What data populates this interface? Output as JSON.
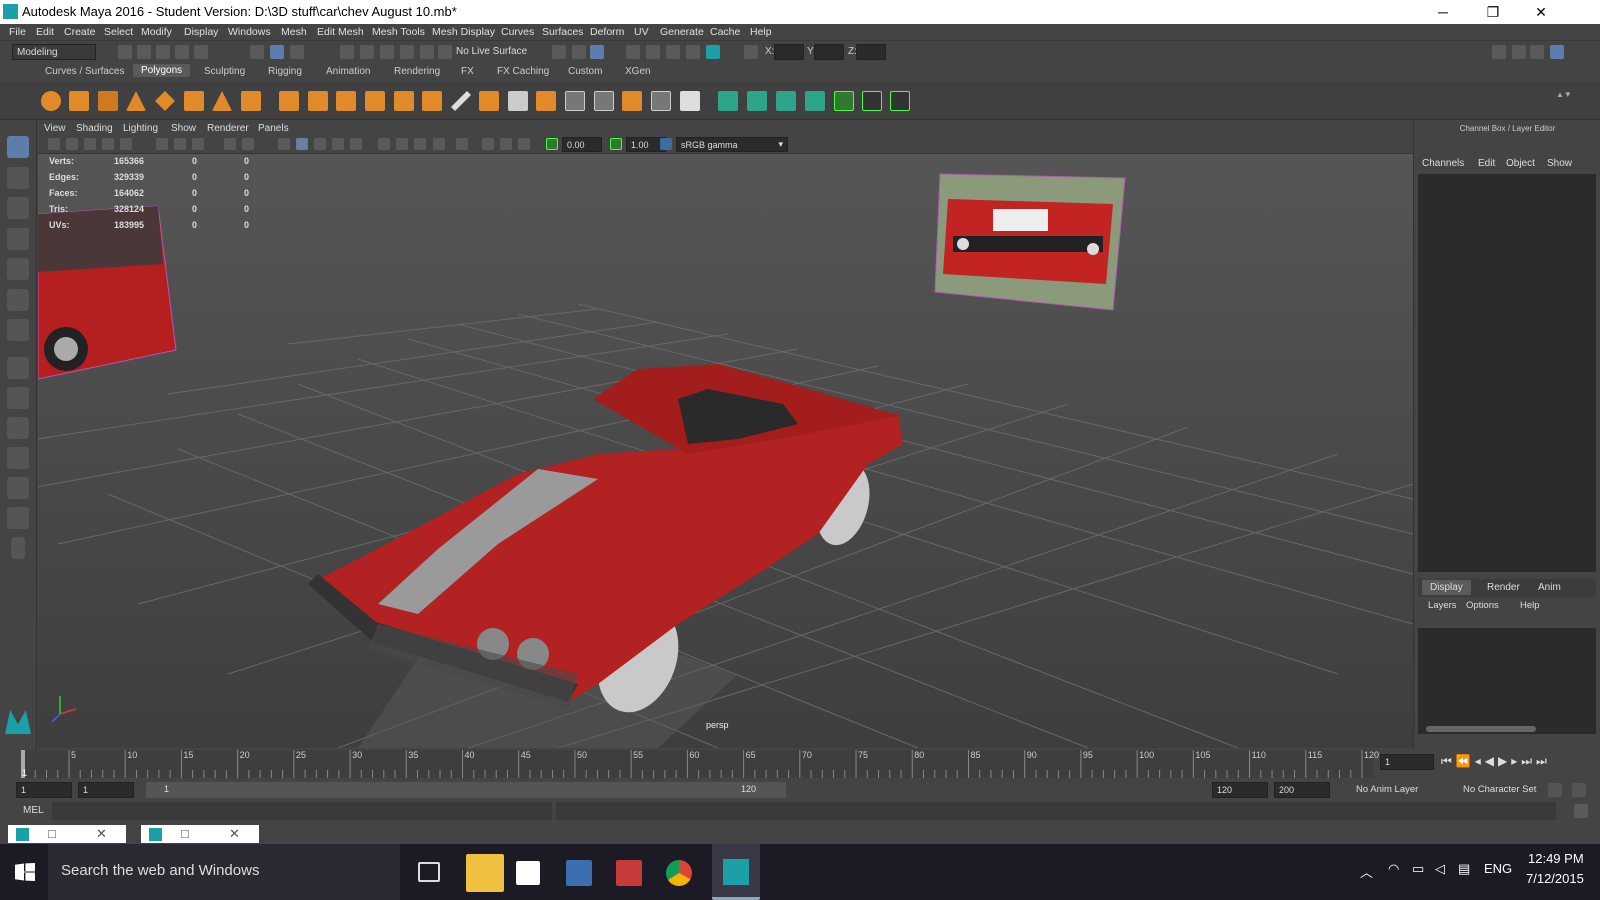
{
  "window": {
    "title": "Autodesk Maya 2016 - Student Version: D:\\3D stuff\\car\\chev  August 10.mb*",
    "min_glyph": "─",
    "max_glyph": "❐",
    "close_glyph": "✕"
  },
  "menus": [
    "File",
    "Edit",
    "Create",
    "Select",
    "Modify",
    "Display",
    "Windows",
    "Mesh",
    "Edit Mesh",
    "Mesh Tools",
    "Mesh Display",
    "Curves",
    "Surfaces",
    "Deform",
    "UV",
    "Generate",
    "Cache",
    "Help"
  ],
  "statusline": {
    "mode": "Modeling",
    "live_surface": "No Live Surface",
    "x_label": "X:",
    "y_label": "Y:",
    "z_label": "Z:"
  },
  "shelf_tabs": [
    "Curves / Surfaces",
    "Polygons",
    "Sculpting",
    "Rigging",
    "Animation",
    "Rendering",
    "FX",
    "FX Caching",
    "Custom",
    "XGen"
  ],
  "shelf_active": "Polygons",
  "viewport": {
    "menus": [
      "View",
      "Shading",
      "Lighting",
      "Show",
      "Renderer",
      "Panels"
    ],
    "exposure": "0.00",
    "gamma": "1.00",
    "color_space": "sRGB gamma",
    "camera": "persp",
    "hud": [
      {
        "label": "Verts:",
        "v1": "165366",
        "v2": "0",
        "v3": "0"
      },
      {
        "label": "Edges:",
        "v1": "329339",
        "v2": "0",
        "v3": "0"
      },
      {
        "label": "Faces:",
        "v1": "164062",
        "v2": "0",
        "v3": "0"
      },
      {
        "label": "Tris:",
        "v1": "328124",
        "v2": "0",
        "v3": "0"
      },
      {
        "label": "UVs:",
        "v1": "183995",
        "v2": "0",
        "v3": "0"
      }
    ]
  },
  "channelbox": {
    "header": "Channel Box / Layer Editor",
    "menus": [
      "Channels",
      "Edit",
      "Object",
      "Show"
    ],
    "layer_tabs": [
      "Display",
      "Render",
      "Anim"
    ],
    "layer_menus": [
      "Layers",
      "Options",
      "Help"
    ]
  },
  "timeline": {
    "ticks": [
      "5",
      "10",
      "15",
      "20",
      "25",
      "30",
      "35",
      "40",
      "45",
      "50",
      "55",
      "60",
      "65",
      "70",
      "75",
      "80",
      "85",
      "90",
      "95",
      "100",
      "105",
      "110",
      "115",
      "120"
    ],
    "current_frame": "1",
    "left_marker": "1"
  },
  "range": {
    "start": "1",
    "start_inner": "1",
    "range_start_label": "1",
    "range_end_label": "120",
    "end_inner": "120",
    "end": "200",
    "anim_layer": "No Anim Layer",
    "char_set": "No Character Set"
  },
  "cmdline": {
    "label": "MEL"
  },
  "taskbar": {
    "search": "Search the web and Windows",
    "time": "12:49 PM",
    "date": "7/12/2015",
    "lang": "ENG"
  }
}
